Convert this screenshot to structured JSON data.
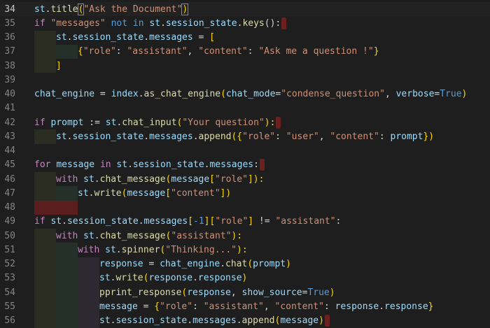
{
  "editor": {
    "first_line": 34,
    "current_line": 34,
    "lines": [
      {
        "n": "34",
        "indent": 0,
        "marker": false,
        "tokens": [
          {
            "t": "st",
            "c": "vr"
          },
          {
            "t": ".",
            "c": "op"
          },
          {
            "t": "title",
            "c": "fn"
          },
          {
            "t": "(",
            "c": "br bm"
          },
          {
            "t": "\"Ask the Document\"",
            "c": "st"
          },
          {
            "t": ")",
            "c": "br bm"
          }
        ]
      },
      {
        "n": "35",
        "indent": 0,
        "marker": true,
        "tokens": [
          {
            "t": "if",
            "c": "kw"
          },
          {
            "t": " ",
            "c": "tx"
          },
          {
            "t": "\"messages\"",
            "c": "st"
          },
          {
            "t": " ",
            "c": "tx"
          },
          {
            "t": "not in",
            "c": "kb"
          },
          {
            "t": " ",
            "c": "tx"
          },
          {
            "t": "st",
            "c": "vr"
          },
          {
            "t": ".",
            "c": "op"
          },
          {
            "t": "session_state",
            "c": "vr"
          },
          {
            "t": ".",
            "c": "op"
          },
          {
            "t": "keys",
            "c": "fn"
          },
          {
            "t": "():",
            "c": "op"
          }
        ]
      },
      {
        "n": "36",
        "indent": 1,
        "marker": false,
        "tokens": [
          {
            "t": "st",
            "c": "vr"
          },
          {
            "t": ".",
            "c": "op"
          },
          {
            "t": "session_state",
            "c": "vr"
          },
          {
            "t": ".",
            "c": "op"
          },
          {
            "t": "messages",
            "c": "vr"
          },
          {
            "t": " = ",
            "c": "op"
          },
          {
            "t": "[",
            "c": "br"
          }
        ]
      },
      {
        "n": "37",
        "indent": 2,
        "marker": false,
        "tokens": [
          {
            "t": "{",
            "c": "br"
          },
          {
            "t": "\"role\"",
            "c": "st"
          },
          {
            "t": ": ",
            "c": "op"
          },
          {
            "t": "\"assistant\"",
            "c": "st"
          },
          {
            "t": ", ",
            "c": "op"
          },
          {
            "t": "\"content\"",
            "c": "st"
          },
          {
            "t": ": ",
            "c": "op"
          },
          {
            "t": "\"Ask me a question !\"",
            "c": "st"
          },
          {
            "t": "}",
            "c": "br"
          }
        ]
      },
      {
        "n": "38",
        "indent": 1,
        "marker": false,
        "tokens": [
          {
            "t": "]",
            "c": "br"
          }
        ]
      },
      {
        "n": "39",
        "indent": 0,
        "marker": false,
        "tokens": []
      },
      {
        "n": "40",
        "indent": 0,
        "marker": false,
        "tokens": [
          {
            "t": "chat_engine",
            "c": "vr"
          },
          {
            "t": " = ",
            "c": "op"
          },
          {
            "t": "index",
            "c": "vr"
          },
          {
            "t": ".",
            "c": "op"
          },
          {
            "t": "as_chat_engine",
            "c": "fn"
          },
          {
            "t": "(",
            "c": "br"
          },
          {
            "t": "chat_mode",
            "c": "vr"
          },
          {
            "t": "=",
            "c": "op"
          },
          {
            "t": "\"condense_question\"",
            "c": "st"
          },
          {
            "t": ", ",
            "c": "op"
          },
          {
            "t": "verbose",
            "c": "vr"
          },
          {
            "t": "=",
            "c": "op"
          },
          {
            "t": "True",
            "c": "kb"
          },
          {
            "t": ")",
            "c": "br"
          }
        ]
      },
      {
        "n": "41",
        "indent": 0,
        "marker": false,
        "tokens": []
      },
      {
        "n": "42",
        "indent": 0,
        "marker": true,
        "tokens": [
          {
            "t": "if",
            "c": "kw"
          },
          {
            "t": " ",
            "c": "tx"
          },
          {
            "t": "prompt",
            "c": "vr"
          },
          {
            "t": " := ",
            "c": "op"
          },
          {
            "t": "st",
            "c": "vr"
          },
          {
            "t": ".",
            "c": "op"
          },
          {
            "t": "chat_input",
            "c": "fn"
          },
          {
            "t": "(",
            "c": "br"
          },
          {
            "t": "\"Your question\"",
            "c": "st"
          },
          {
            "t": "):",
            "c": "br"
          }
        ]
      },
      {
        "n": "43",
        "indent": 1,
        "marker": false,
        "tokens": [
          {
            "t": "st",
            "c": "vr"
          },
          {
            "t": ".",
            "c": "op"
          },
          {
            "t": "session_state",
            "c": "vr"
          },
          {
            "t": ".",
            "c": "op"
          },
          {
            "t": "messages",
            "c": "vr"
          },
          {
            "t": ".",
            "c": "op"
          },
          {
            "t": "append",
            "c": "fn"
          },
          {
            "t": "({",
            "c": "br"
          },
          {
            "t": "\"role\"",
            "c": "st"
          },
          {
            "t": ": ",
            "c": "op"
          },
          {
            "t": "\"user\"",
            "c": "st"
          },
          {
            "t": ", ",
            "c": "op"
          },
          {
            "t": "\"content\"",
            "c": "st"
          },
          {
            "t": ": ",
            "c": "op"
          },
          {
            "t": "prompt",
            "c": "vr"
          },
          {
            "t": "})",
            "c": "br"
          }
        ]
      },
      {
        "n": "44",
        "indent": 0,
        "marker": false,
        "tokens": []
      },
      {
        "n": "45",
        "indent": 0,
        "marker": true,
        "tokens": [
          {
            "t": "for",
            "c": "kw"
          },
          {
            "t": " ",
            "c": "tx"
          },
          {
            "t": "message",
            "c": "vr"
          },
          {
            "t": " ",
            "c": "tx"
          },
          {
            "t": "in",
            "c": "kw"
          },
          {
            "t": " ",
            "c": "tx"
          },
          {
            "t": "st",
            "c": "vr"
          },
          {
            "t": ".",
            "c": "op"
          },
          {
            "t": "session_state",
            "c": "vr"
          },
          {
            "t": ".",
            "c": "op"
          },
          {
            "t": "messages",
            "c": "vr"
          },
          {
            "t": ":",
            "c": "op"
          }
        ]
      },
      {
        "n": "46",
        "indent": 1,
        "marker": false,
        "tokens": [
          {
            "t": "with",
            "c": "kw"
          },
          {
            "t": " ",
            "c": "tx"
          },
          {
            "t": "st",
            "c": "vr"
          },
          {
            "t": ".",
            "c": "op"
          },
          {
            "t": "chat_message",
            "c": "fn"
          },
          {
            "t": "(",
            "c": "br"
          },
          {
            "t": "message",
            "c": "vr"
          },
          {
            "t": "[",
            "c": "br"
          },
          {
            "t": "\"role\"",
            "c": "st"
          },
          {
            "t": "]",
            "c": "br"
          },
          {
            "t": "):",
            "c": "br"
          }
        ]
      },
      {
        "n": "47",
        "indent": 2,
        "marker": false,
        "tokens": [
          {
            "t": "st",
            "c": "vr"
          },
          {
            "t": ".",
            "c": "op"
          },
          {
            "t": "write",
            "c": "fn"
          },
          {
            "t": "(",
            "c": "br"
          },
          {
            "t": "message",
            "c": "vr"
          },
          {
            "t": "[",
            "c": "br"
          },
          {
            "t": "\"content\"",
            "c": "st"
          },
          {
            "t": "]",
            "c": "br"
          },
          {
            "t": ")",
            "c": "br"
          }
        ]
      },
      {
        "n": "48",
        "indent": -1,
        "marker": false,
        "tokens": []
      },
      {
        "n": "49",
        "indent": 0,
        "marker": false,
        "tokens": [
          {
            "t": "if",
            "c": "kw"
          },
          {
            "t": " ",
            "c": "tx"
          },
          {
            "t": "st",
            "c": "vr"
          },
          {
            "t": ".",
            "c": "op"
          },
          {
            "t": "session_state",
            "c": "vr"
          },
          {
            "t": ".",
            "c": "op"
          },
          {
            "t": "messages",
            "c": "vr"
          },
          {
            "t": "[",
            "c": "br"
          },
          {
            "t": "-1",
            "c": "kb"
          },
          {
            "t": "][",
            "c": "br"
          },
          {
            "t": "\"role\"",
            "c": "st"
          },
          {
            "t": "]",
            "c": "br"
          },
          {
            "t": " != ",
            "c": "op"
          },
          {
            "t": "\"assistant\"",
            "c": "st"
          },
          {
            "t": ":",
            "c": "op"
          }
        ]
      },
      {
        "n": "50",
        "indent": 1,
        "marker": false,
        "tokens": [
          {
            "t": "with",
            "c": "kw"
          },
          {
            "t": " ",
            "c": "tx"
          },
          {
            "t": "st",
            "c": "vr"
          },
          {
            "t": ".",
            "c": "op"
          },
          {
            "t": "chat_message",
            "c": "fn"
          },
          {
            "t": "(",
            "c": "br"
          },
          {
            "t": "\"assistant\"",
            "c": "st"
          },
          {
            "t": "):",
            "c": "br"
          }
        ]
      },
      {
        "n": "51",
        "indent": 2,
        "marker": false,
        "tokens": [
          {
            "t": "with",
            "c": "kw"
          },
          {
            "t": " ",
            "c": "tx"
          },
          {
            "t": "st",
            "c": "vr"
          },
          {
            "t": ".",
            "c": "op"
          },
          {
            "t": "spinner",
            "c": "fn"
          },
          {
            "t": "(",
            "c": "br"
          },
          {
            "t": "\"Thinking...\"",
            "c": "st"
          },
          {
            "t": "):",
            "c": "br"
          }
        ]
      },
      {
        "n": "52",
        "indent": 3,
        "marker": false,
        "tokens": [
          {
            "t": "response",
            "c": "vr"
          },
          {
            "t": " = ",
            "c": "op"
          },
          {
            "t": "chat_engine",
            "c": "vr"
          },
          {
            "t": ".",
            "c": "op"
          },
          {
            "t": "chat",
            "c": "fn"
          },
          {
            "t": "(",
            "c": "br"
          },
          {
            "t": "prompt",
            "c": "vr"
          },
          {
            "t": ")",
            "c": "br"
          }
        ]
      },
      {
        "n": "53",
        "indent": 3,
        "marker": false,
        "tokens": [
          {
            "t": "st",
            "c": "vr"
          },
          {
            "t": ".",
            "c": "op"
          },
          {
            "t": "write",
            "c": "fn"
          },
          {
            "t": "(",
            "c": "br"
          },
          {
            "t": "response",
            "c": "vr"
          },
          {
            "t": ".",
            "c": "op"
          },
          {
            "t": "response",
            "c": "vr"
          },
          {
            "t": ")",
            "c": "br"
          }
        ]
      },
      {
        "n": "54",
        "indent": 3,
        "marker": false,
        "tokens": [
          {
            "t": "pprint_response",
            "c": "fn"
          },
          {
            "t": "(",
            "c": "br"
          },
          {
            "t": "response",
            "c": "vr"
          },
          {
            "t": ", ",
            "c": "op"
          },
          {
            "t": "show_source",
            "c": "vr"
          },
          {
            "t": "=",
            "c": "op"
          },
          {
            "t": "True",
            "c": "kb"
          },
          {
            "t": ")",
            "c": "br"
          }
        ]
      },
      {
        "n": "55",
        "indent": 3,
        "marker": false,
        "tokens": [
          {
            "t": "message",
            "c": "vr"
          },
          {
            "t": " = ",
            "c": "op"
          },
          {
            "t": "{",
            "c": "br"
          },
          {
            "t": "\"role\"",
            "c": "st"
          },
          {
            "t": ": ",
            "c": "op"
          },
          {
            "t": "\"assistant\"",
            "c": "st"
          },
          {
            "t": ", ",
            "c": "op"
          },
          {
            "t": "\"content\"",
            "c": "st"
          },
          {
            "t": ": ",
            "c": "op"
          },
          {
            "t": "response",
            "c": "vr"
          },
          {
            "t": ".",
            "c": "op"
          },
          {
            "t": "response",
            "c": "vr"
          },
          {
            "t": "}",
            "c": "br"
          }
        ]
      },
      {
        "n": "56",
        "indent": 3,
        "marker": true,
        "tokens": [
          {
            "t": "st",
            "c": "vr"
          },
          {
            "t": ".",
            "c": "op"
          },
          {
            "t": "session_state",
            "c": "vr"
          },
          {
            "t": ".",
            "c": "op"
          },
          {
            "t": "messages",
            "c": "vr"
          },
          {
            "t": ".",
            "c": "op"
          },
          {
            "t": "append",
            "c": "fn"
          },
          {
            "t": "(",
            "c": "br"
          },
          {
            "t": "message",
            "c": "vr"
          },
          {
            "t": ")",
            "c": "br"
          }
        ]
      }
    ]
  }
}
